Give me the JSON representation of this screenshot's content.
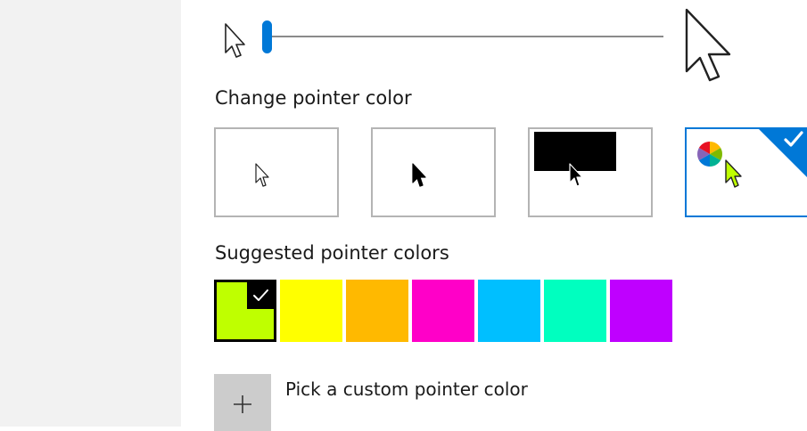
{
  "size_slider": {
    "small_icon": "cursor-small-icon",
    "large_icon": "cursor-large-icon",
    "accent": "#0078d7"
  },
  "pointer_color": {
    "title": "Change pointer color",
    "options": [
      {
        "id": "white",
        "icon": "white-cursor-icon",
        "selected": false
      },
      {
        "id": "black",
        "icon": "black-cursor-icon",
        "selected": false
      },
      {
        "id": "inverted",
        "icon": "inverted-cursor-icon",
        "selected": false
      },
      {
        "id": "custom",
        "icon": "color-wheel-cursor-icon",
        "selected": true
      }
    ]
  },
  "suggested": {
    "title": "Suggested pointer colors",
    "colors": [
      {
        "hex": "#bfff00",
        "selected": true
      },
      {
        "hex": "#ffff00",
        "selected": false
      },
      {
        "hex": "#ffb900",
        "selected": false
      },
      {
        "hex": "#ff00c8",
        "selected": false
      },
      {
        "hex": "#00bfff",
        "selected": false
      },
      {
        "hex": "#00ffbf",
        "selected": false
      },
      {
        "hex": "#bf00ff",
        "selected": false
      }
    ]
  },
  "custom": {
    "label": "Pick a custom pointer color",
    "icon": "plus-icon"
  }
}
